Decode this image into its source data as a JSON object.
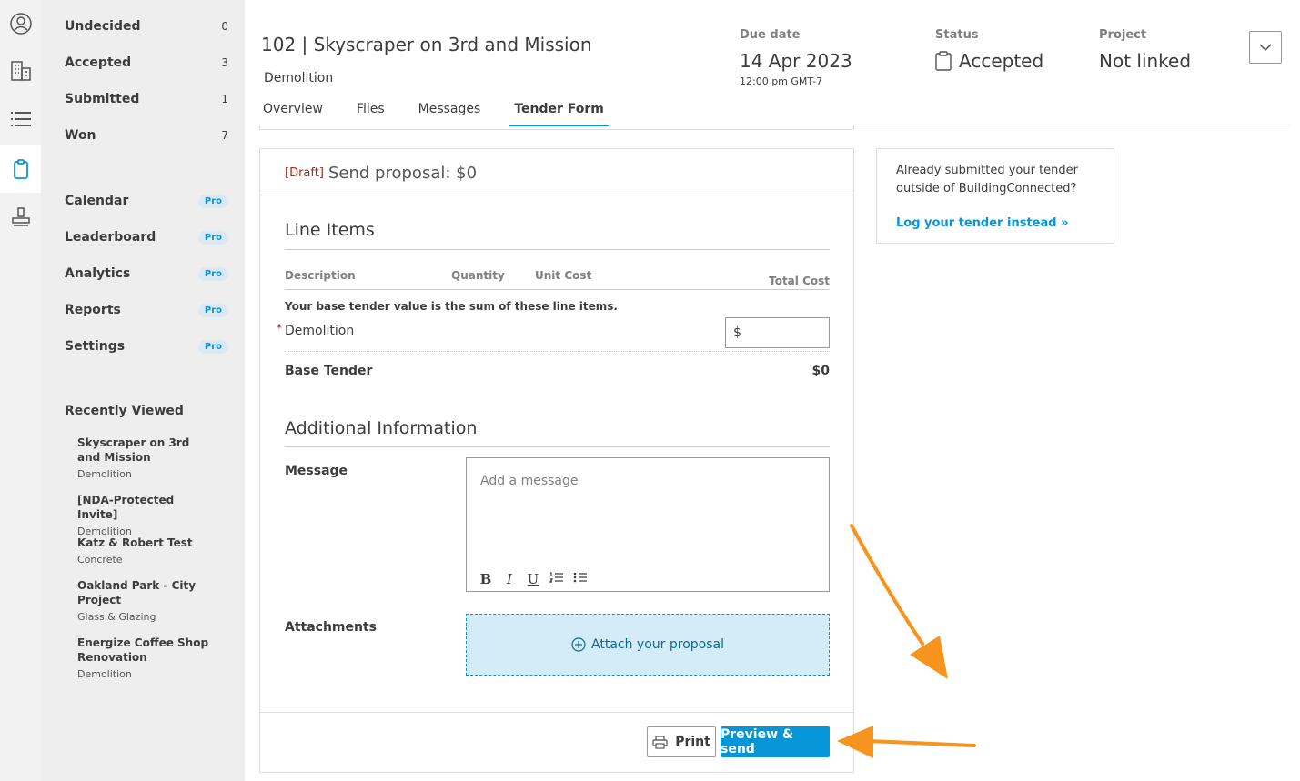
{
  "rail": {
    "items": [
      "profile-icon",
      "building-icon",
      "list-icon",
      "clipboard-icon",
      "stamp-icon"
    ],
    "active_color": "#0696d7"
  },
  "sidebar": {
    "status_items": [
      {
        "label": "Undecided",
        "count": "0"
      },
      {
        "label": "Accepted",
        "count": "3"
      },
      {
        "label": "Submitted",
        "count": "1"
      },
      {
        "label": "Won",
        "count": "7"
      }
    ],
    "pro_items": [
      {
        "label": "Calendar",
        "badge": "Pro"
      },
      {
        "label": "Leaderboard",
        "badge": "Pro"
      },
      {
        "label": "Analytics",
        "badge": "Pro"
      },
      {
        "label": "Reports",
        "badge": "Pro"
      },
      {
        "label": "Settings",
        "badge": "Pro"
      }
    ],
    "recently_viewed_title": "Recently Viewed",
    "recently_viewed": [
      {
        "name": "Skyscraper on 3rd and Mission",
        "trade": "Demolition"
      },
      {
        "name": "[NDA-Protected Invite]",
        "trade": "Demolition"
      },
      {
        "name": "Katz & Robert Test",
        "trade": "Concrete"
      },
      {
        "name": "Oakland Park - City Project",
        "trade": "Glass & Glazing"
      },
      {
        "name": "Energize Coffee Shop Renovation",
        "trade": "Demolition"
      }
    ]
  },
  "header": {
    "title": "102 | Skyscraper on 3rd and Mission",
    "subtitle": "Demolition",
    "due_label": "Due date",
    "due_value": "14 Apr 2023",
    "due_time": "12:00 pm GMT-7",
    "status_label": "Status",
    "status_value": "Accepted",
    "project_label": "Project",
    "project_value": "Not linked"
  },
  "tabs": [
    {
      "label": "Overview"
    },
    {
      "label": "Files"
    },
    {
      "label": "Messages"
    },
    {
      "label": "Tender Form",
      "active": true
    }
  ],
  "form": {
    "draft_tag": "[Draft]",
    "title": "Send proposal: $0",
    "line_items_title": "Line Items",
    "columns": {
      "description": "Description",
      "quantity": "Quantity",
      "unit_cost": "Unit Cost",
      "total_cost": "Total Cost"
    },
    "note": "Your base tender value is the sum of these line items.",
    "required_mark": "*",
    "line_item_label": "Demolition",
    "line_item_value": "$",
    "base_label": "Base Tender",
    "base_value": "$0",
    "additional_title": "Additional Information",
    "message_label": "Message",
    "message_placeholder": "Add a message",
    "toolbar": {
      "bold": "B",
      "italic": "I",
      "underline": "U"
    },
    "attachments_label": "Attachments",
    "attach_label": "Attach your proposal",
    "print_label": "Print",
    "send_label": "Preview & send"
  },
  "info": {
    "text": "Already submitted your tender outside of BuildingConnected?",
    "link": "Log your tender instead »"
  },
  "colors": {
    "accent": "#0696d7",
    "arrow": "#f7941d",
    "draft": "#a02a1a"
  }
}
